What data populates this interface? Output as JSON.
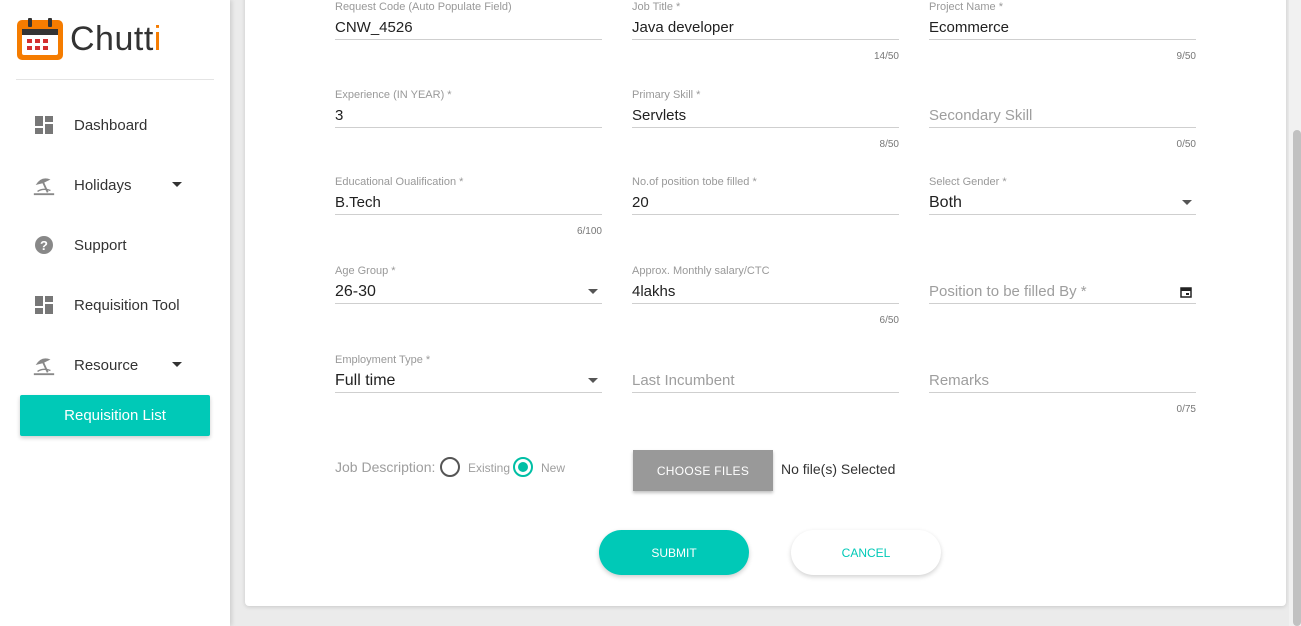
{
  "app": {
    "name_main": "Chutt",
    "name_accent": "i",
    "accent_color": "#f57c00",
    "brand_color": "#00c9b7"
  },
  "sidebar": {
    "items": [
      {
        "label": "Dashboard",
        "icon": "dashboard-icon"
      },
      {
        "label": "Holidays",
        "icon": "beach-icon",
        "has_dropdown": true
      },
      {
        "label": "Support",
        "icon": "help-icon"
      },
      {
        "label": "Requisition Tool",
        "icon": "dashboard-icon"
      },
      {
        "label": "Resource",
        "icon": "beach-icon",
        "has_dropdown": true
      }
    ],
    "active_sub": {
      "label": "Requisition List"
    }
  },
  "form": {
    "request_code": {
      "label": "Request Code (Auto Populate Field)",
      "value": "CNW_4526"
    },
    "job_title": {
      "label": "Job Title *",
      "value": "Java developer",
      "count": "14/50"
    },
    "project_name": {
      "label": "Project Name *",
      "value": "Ecommerce",
      "count": "9/50"
    },
    "experience": {
      "label": "Experience (IN YEAR) *",
      "value": "3"
    },
    "primary_skill": {
      "label": "Primary Skill *",
      "value": "Servlets",
      "count": "8/50"
    },
    "secondary_skill": {
      "placeholder": "Secondary Skill",
      "count": "0/50"
    },
    "education": {
      "label": "Educational Oualification *",
      "value": "B.Tech",
      "count": "6/100"
    },
    "positions": {
      "label": "No.of position tobe filled *",
      "value": "20"
    },
    "gender": {
      "label": "Select Gender *",
      "value": "Both"
    },
    "age_group": {
      "label": "Age Group *",
      "value": "26-30"
    },
    "salary": {
      "label": "Approx. Monthly salary/CTC",
      "value": "4lakhs",
      "count": "6/50"
    },
    "filled_by": {
      "placeholder": "Position to be filled By *"
    },
    "employment_type": {
      "label": "Employment Type *",
      "value": "Full time"
    },
    "last_incumbent": {
      "placeholder": "Last Incumbent"
    },
    "remarks": {
      "placeholder": "Remarks",
      "count": "0/75"
    },
    "job_description": {
      "label": "Job Description:",
      "options": [
        {
          "label": "Existing",
          "checked": false
        },
        {
          "label": "New",
          "checked": true
        }
      ]
    },
    "choose_files": {
      "label": "CHOOSE FILES",
      "status": "No file(s) Selected"
    },
    "submit_label": "SUBMIT",
    "cancel_label": "CANCEL"
  }
}
